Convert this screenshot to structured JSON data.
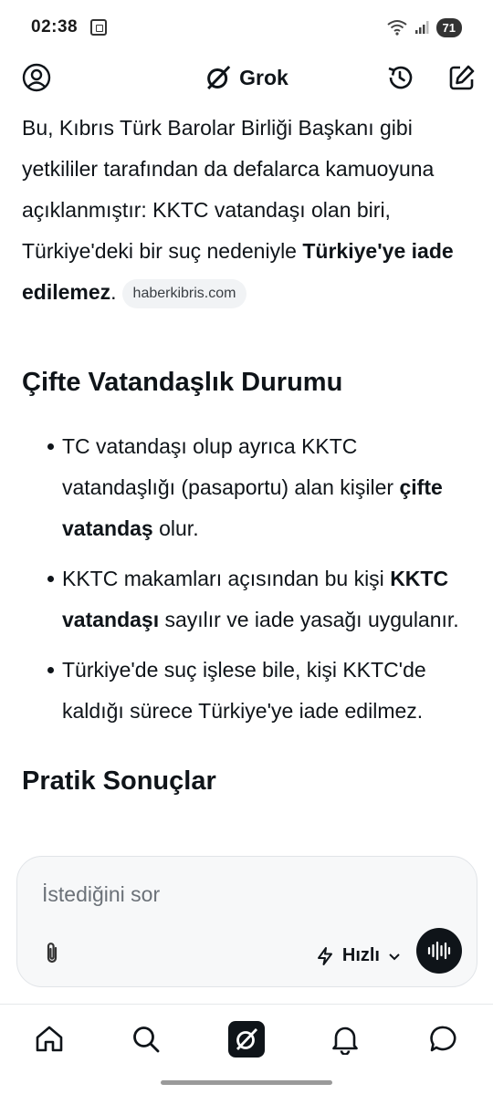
{
  "status_bar": {
    "time": "02:38",
    "battery": "71"
  },
  "header": {
    "brand": "Grok"
  },
  "content": {
    "intro": {
      "part1": "Bu, Kıbrıs Türk Barolar Birliği Başkanı gibi yetkililer tarafından da defalarca kamuoyuna açıklanmıştır: KKTC vatandaşı olan biri, Türkiye'deki bir suç nedeniyle ",
      "bold": "Türkiye'ye iade edilemez",
      "part2": ".",
      "source": "haberkibris.com"
    },
    "section1_title": "Çifte Vatandaşlık Durumu",
    "bullets": [
      {
        "pre": "TC vatandaşı olup ayrıca KKTC vatandaşlığı (pasaportu) alan kişiler ",
        "bold": "çifte vatandaş",
        "post": " olur."
      },
      {
        "pre": "KKTC makamları açısından bu kişi ",
        "bold": "KKTC vatandaşı",
        "post": " sayılır ve iade yasağı uygulanır."
      },
      {
        "pre": "Türkiye'de suç işlese bile, kişi KKTC'de kaldığı sürece Türkiye'ye iade edilmez.",
        "bold": "",
        "post": ""
      }
    ],
    "section2_title": "Pratik Sonuçlar"
  },
  "composer": {
    "placeholder": "İstediğini sor",
    "mode_label": "Hızlı"
  },
  "icons": {
    "profile": "profile-icon",
    "history": "history-icon",
    "compose": "compose-icon",
    "attach": "paperclip-icon",
    "mode": "lightning-icon",
    "voice": "voice-wave-icon",
    "home": "home-icon",
    "search": "search-icon",
    "grok": "grok-icon",
    "notifications": "bell-icon",
    "messages": "chat-bubble-icon"
  },
  "colors": {
    "text": "#0f1419",
    "chip_bg": "#f1f3f5",
    "composer_bg": "#f7f8f9",
    "placeholder": "#6b7178"
  }
}
